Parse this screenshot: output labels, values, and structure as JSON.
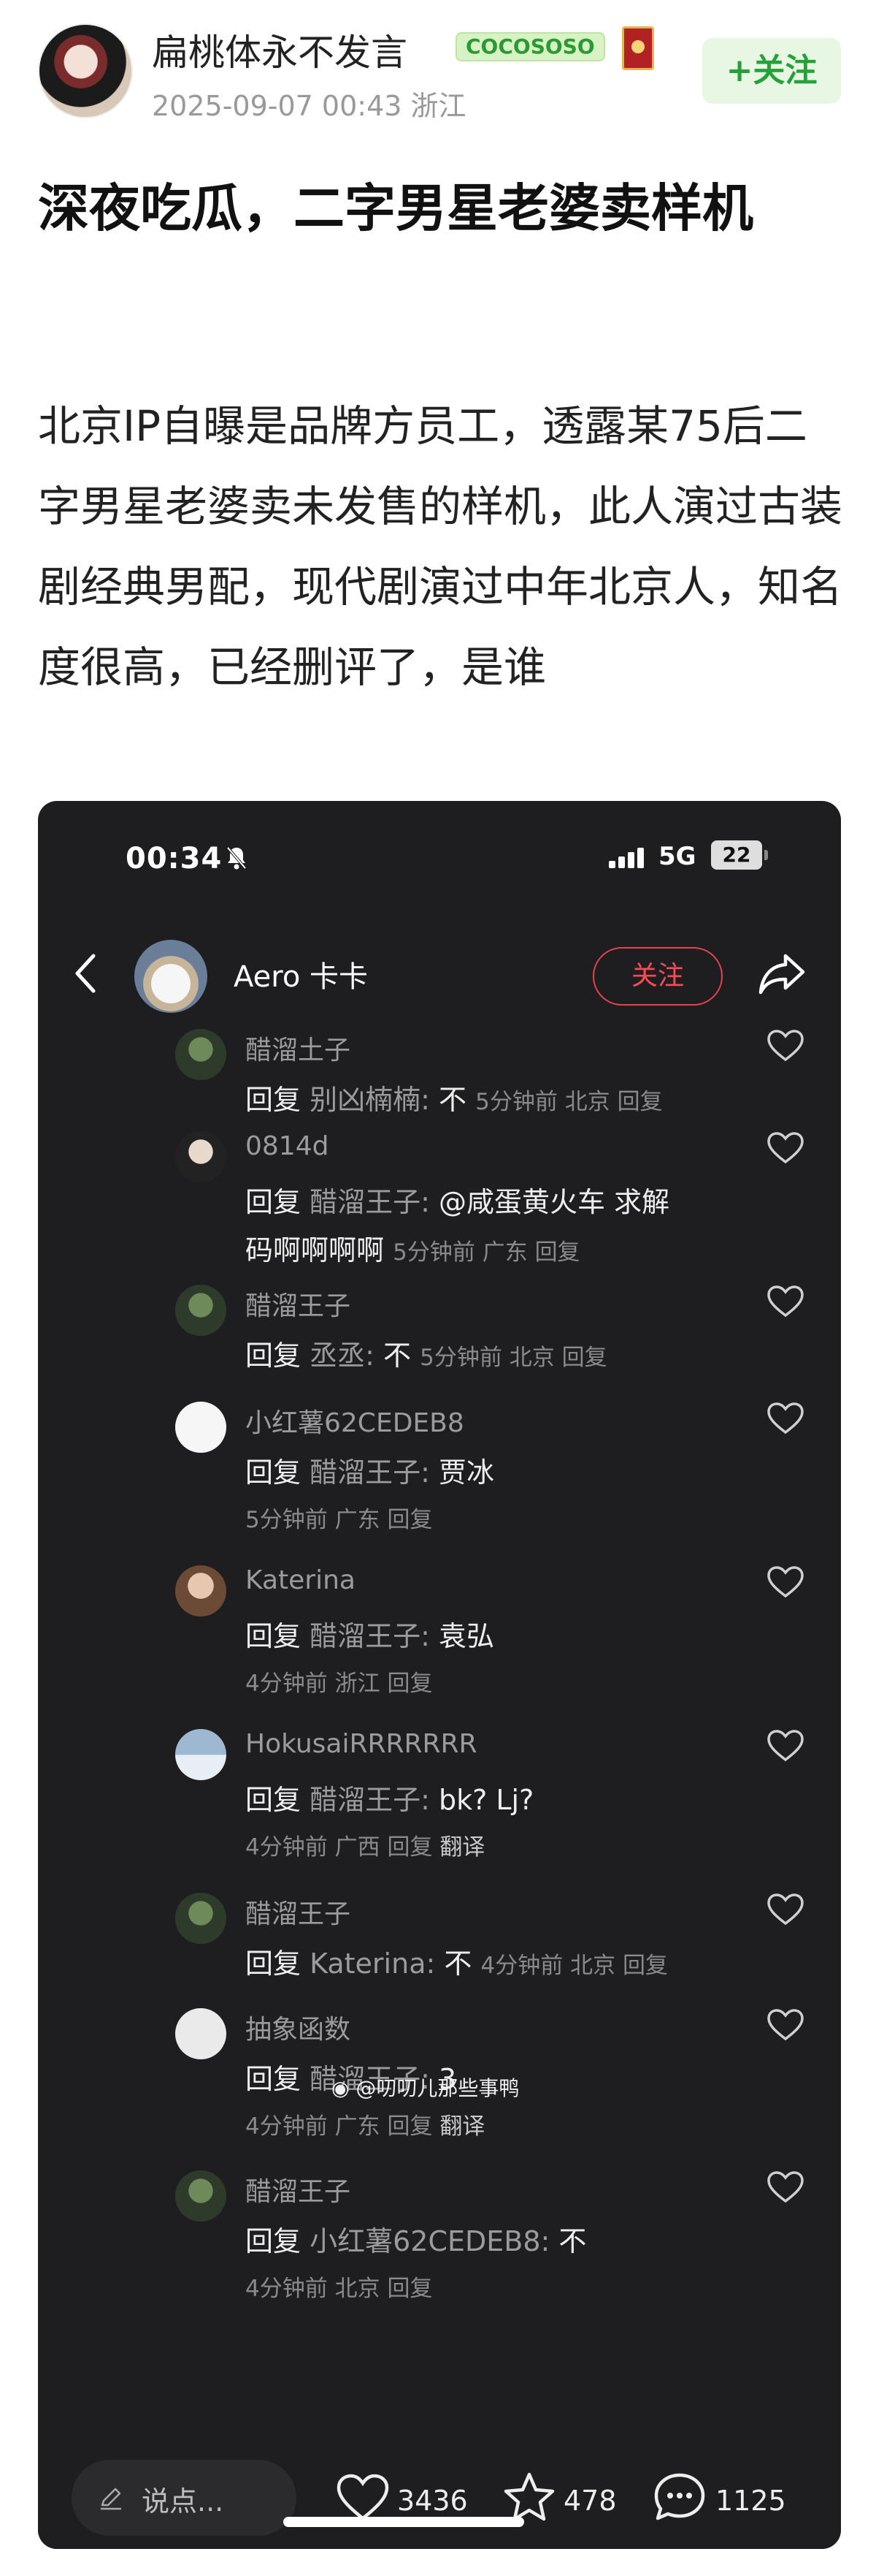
{
  "post": {
    "author": "扁桃体永不发言",
    "badge": "COCOSOSO",
    "date": "2025-09-07 00:43",
    "location": "浙江",
    "follow_label": "+关注",
    "title": "深夜吃瓜，二字男星老婆卖样机",
    "body": "北京IP自曝是品牌方员工，透露某75后二字男星老婆卖未发售的样机，此人演过古装剧经典男配，现代剧演过中年北京人，知名度很高，已经删评了，是谁"
  },
  "phone": {
    "status": {
      "time": "00:34",
      "network": "5G",
      "battery": "22"
    },
    "header": {
      "username": "Aero 卡卡",
      "follow_label": "关注"
    },
    "comments": [
      {
        "name": "醋溜土子",
        "prefix": "回复",
        "to": "别凶楠楠:",
        "text": "不",
        "time": "5分钟前",
        "loc": "北京",
        "reply": "回复",
        "inline": true
      },
      {
        "name": "0814d",
        "prefix": "回复",
        "to": "醋溜王子:",
        "text": "@咸蛋黄火车 求解",
        "cont": "码啊啊啊啊",
        "time": "5分钟前",
        "loc": "广东",
        "reply": "回复"
      },
      {
        "name": "醋溜王子",
        "prefix": "回复",
        "to": "丞丞:",
        "text": "不",
        "time": "5分钟前",
        "loc": "北京",
        "reply": "回复",
        "inline": true
      },
      {
        "name": "小红薯62CEDEB8",
        "prefix": "回复",
        "to": "醋溜王子:",
        "text": "贾冰",
        "time": "5分钟前",
        "loc": "广东",
        "reply": "回复"
      },
      {
        "name": "Katerina",
        "prefix": "回复",
        "to": "醋溜王子:",
        "text": "袁弘",
        "time": "4分钟前",
        "loc": "浙江",
        "reply": "回复"
      },
      {
        "name": "HokusaiRRRRRRR",
        "prefix": "回复",
        "to": "醋溜王子:",
        "text": "bk? Lj?",
        "time": "4分钟前",
        "loc": "广西",
        "reply": "回复",
        "translate": "翻译"
      },
      {
        "name": "醋溜王子",
        "prefix": "回复",
        "to": "Katerina:",
        "text": "不",
        "time": "4分钟前",
        "loc": "北京",
        "reply": "回复",
        "inline": true
      },
      {
        "name": "抽象函数",
        "prefix": "回复",
        "to": "醋溜王子:",
        "text": "3",
        "time": "4分钟前",
        "loc": "广东",
        "reply": "回复",
        "translate": "翻译"
      },
      {
        "name": "醋溜王子",
        "prefix": "回复",
        "to": "小红薯62CEDEB8:",
        "text": "不",
        "time": "4分钟前",
        "loc": "北京",
        "reply": "回复"
      }
    ],
    "watermark": "@叨叨儿那些事鸭",
    "bottom": {
      "placeholder": "说点...",
      "likes": "3436",
      "stars": "478",
      "comments": "1125"
    }
  }
}
